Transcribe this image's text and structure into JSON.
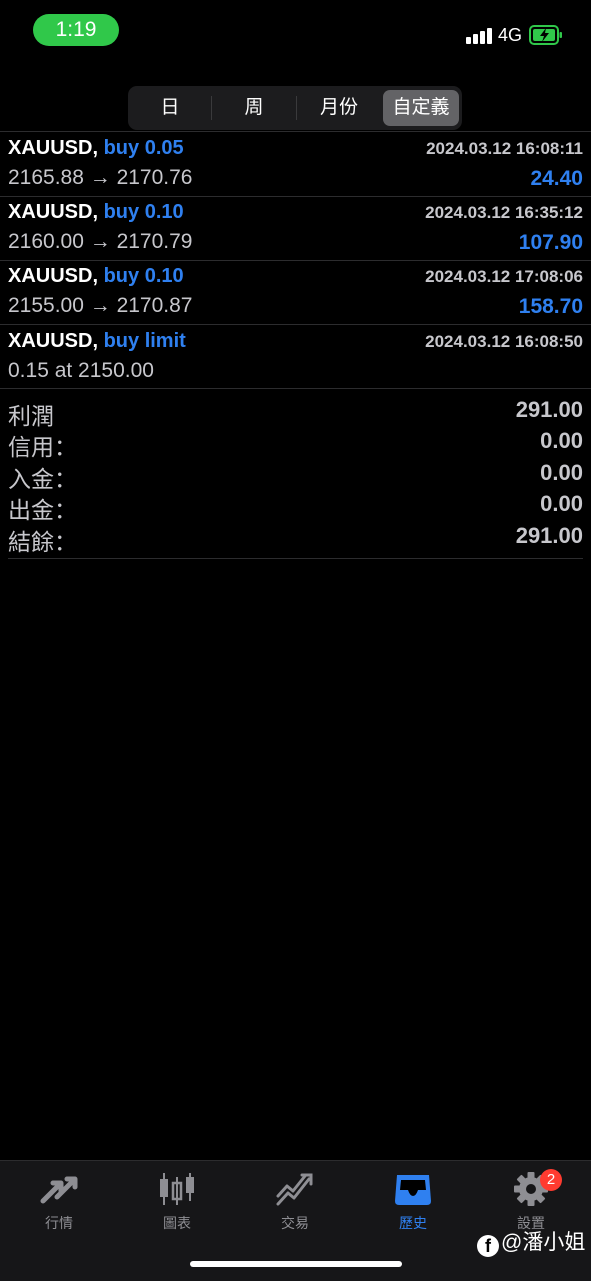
{
  "status": {
    "time": "1:19",
    "network": "4G"
  },
  "tabs": [
    "日",
    "周",
    "月份",
    "自定義"
  ],
  "active_tab": "自定義",
  "trades": [
    {
      "symbol": "XAUUSD,",
      "side": "buy 0.05",
      "datetime": "2024.03.12 16:08:11",
      "prices": "2165.88 → 2170.76",
      "profit": "24.40"
    },
    {
      "symbol": "XAUUSD,",
      "side": "buy 0.10",
      "datetime": "2024.03.12 16:35:12",
      "prices": "2160.00 → 2170.79",
      "profit": "107.90"
    },
    {
      "symbol": "XAUUSD,",
      "side": "buy 0.10",
      "datetime": "2024.03.12 17:08:06",
      "prices": "2155.00 → 2170.87",
      "profit": "158.70"
    },
    {
      "symbol": "XAUUSD,",
      "side": "buy limit",
      "datetime": "2024.03.12 16:08:50",
      "prices": "0.15 at 2150.00",
      "profit": ""
    }
  ],
  "summary": [
    {
      "label": "利潤",
      "value": "291.00"
    },
    {
      "label": "信用：",
      "value": "0.00"
    },
    {
      "label": "入金：",
      "value": "0.00"
    },
    {
      "label": "出金：",
      "value": "0.00"
    },
    {
      "label": "結餘：",
      "value": "291.00"
    }
  ],
  "tabbar": {
    "items": [
      {
        "label": "行情",
        "icon": "quotes-arrows-icon"
      },
      {
        "label": "圖表",
        "icon": "candlestick-chart-icon"
      },
      {
        "label": "交易",
        "icon": "trade-trend-icon"
      },
      {
        "label": "歷史",
        "icon": "history-inbox-icon"
      },
      {
        "label": "設置",
        "icon": "settings-gear-icon"
      }
    ],
    "active": "歷史",
    "settings_badge": "2"
  },
  "watermark": "@潘小姐",
  "colors": {
    "accent": "#2f80f0",
    "time_pill": "#30c84a",
    "badge": "#ff3b30",
    "background": "#000000"
  }
}
